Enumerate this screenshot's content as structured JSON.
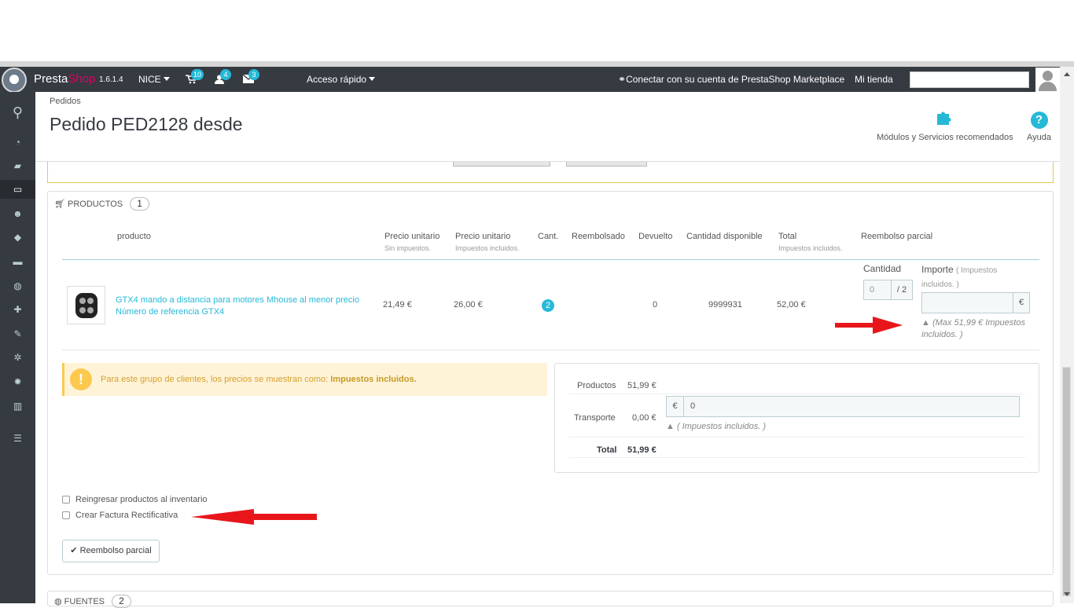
{
  "header": {
    "brand_presta": "Presta",
    "brand_shop": "Shop",
    "version": "1.6.1.4",
    "shop_selector": "NICE",
    "cart_count": "10",
    "customers_count": "4",
    "messages_count": "3",
    "quick_access": "Acceso rápido",
    "marketplace": "Conectar con su cuenta de PrestaShop Marketplace",
    "my_shop": "Mi tienda",
    "search_value": ""
  },
  "page": {
    "breadcrumb": "Pedidos",
    "title": "Pedido PED2128 desde",
    "toolbar": {
      "modules": "Módulos y Servicios recomendados",
      "help": "Ayuda"
    }
  },
  "products_panel": {
    "heading": "PRODUCTOS",
    "count": "1",
    "columns": {
      "product": "producto",
      "unit_price": "Precio unitario",
      "unit_price_sub": "Sin impuestos.",
      "unit_price_tax": "Precio unitario",
      "unit_price_tax_sub": "Impuestos incluidos.",
      "qty": "Cant.",
      "refunded": "Reembolsado",
      "returned": "Devuelto",
      "available": "Cantidad disponible",
      "total": "Total",
      "total_sub": "Impuestos incluidos.",
      "partial_refund": "Reembolso parcial"
    },
    "row": {
      "name": "GTX4 mando a distancia para motores Mhouse al menor precio",
      "reference": "Número de referencia GTX4",
      "unit_price": "21,49 €",
      "unit_price_tax": "26,00 €",
      "qty": "2",
      "returned": "0",
      "available": "9999931",
      "total": "52,00 €",
      "refund_qty_label": "Cantidad",
      "refund_qty_value": "0",
      "refund_qty_max": "/ 2",
      "refund_amount_label": "Importe",
      "refund_amount_sub": "( Impuestos incluidos. )",
      "refund_amount_value": "",
      "currency": "€",
      "max_note": "(Max 51,99 € Impuestos incluidos. )"
    },
    "alert": {
      "text": "Para este grupo de clientes, los precios se muestran como:",
      "bold": "Impuestos incluidos."
    },
    "totals": {
      "products_label": "Productos",
      "products_value": "51,99 €",
      "shipping_label": "Transporte",
      "shipping_value": "0,00 €",
      "shipping_currency": "€",
      "shipping_input": "0",
      "shipping_note": "( Impuestos incluidos. )",
      "total_label": "Total",
      "total_value": "51,99 €"
    },
    "restock_label": "Reingresar productos al inventario",
    "credit_slip_label": "Crear Factura Rectificativa",
    "submit_label": "Reembolso parcial"
  },
  "next_panel": {
    "heading": "FUENTES",
    "count": "2"
  },
  "colors": {
    "accent": "#25b9d7",
    "header_bg": "#363a41",
    "brand_pink": "#df0067",
    "warning": "#fcc94f",
    "annotation_red": "#e8161b"
  }
}
